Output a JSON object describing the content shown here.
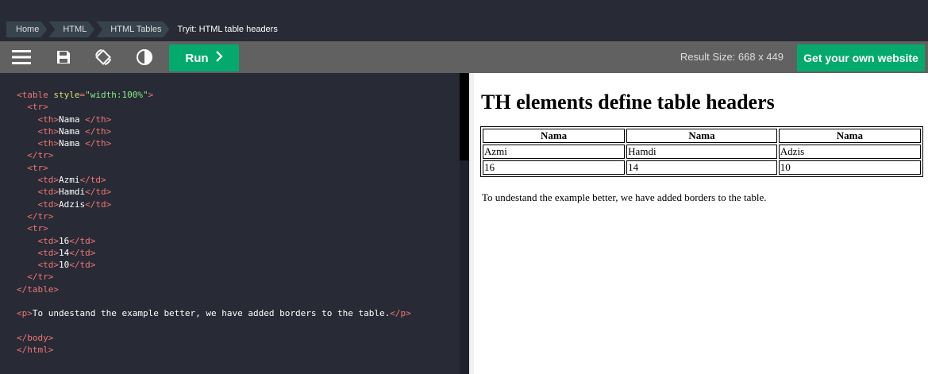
{
  "breadcrumbs": [
    "Home",
    "HTML",
    "HTML Tables",
    "Tryit: HTML table headers"
  ],
  "toolbar": {
    "menu_icon": "hamburger-menu-icon",
    "save_icon": "floppy-disk-icon",
    "rotate_icon": "rotate-layout-icon",
    "theme_icon": "contrast-toggle-icon",
    "run_label": "Run",
    "run_icon": "chevron-right-icon",
    "result_size": "Result Size: 668 x 449",
    "get_site_label": "Get your own website"
  },
  "colors": {
    "accent": "#04aa6d",
    "editor_bg": "#282a35",
    "toolbar_bg": "#616161",
    "tag_color": "#ee7777",
    "attr_color": "#dddd77",
    "value_color": "#88ee88"
  },
  "code": {
    "lines": [
      "<table style=\"width:100%\">",
      "  <tr>",
      "    <th>Nama </th>",
      "    <th>Nama </th>",
      "    <th>Nama </th>",
      "  </tr>",
      "  <tr>",
      "    <td>Azmi</td>",
      "    <td>Hamdi</td>",
      "    <td>Adzis</td>",
      "  </tr>",
      "  <tr>",
      "    <td>16</td>",
      "    <td>14</td>",
      "    <td>10</td>",
      "  </tr>",
      "</table>",
      "",
      "<p>To undestand the example better, we have added borders to the table.</p>",
      "",
      "</body>",
      "</html>"
    ]
  },
  "result": {
    "heading": "TH elements define table headers",
    "table": {
      "headers": [
        "Nama",
        "Nama",
        "Nama"
      ],
      "rows": [
        [
          "Azmi",
          "Hamdi",
          "Adzis"
        ],
        [
          "16",
          "14",
          "10"
        ]
      ]
    },
    "paragraph": "To undestand the example better, we have added borders to the table."
  }
}
